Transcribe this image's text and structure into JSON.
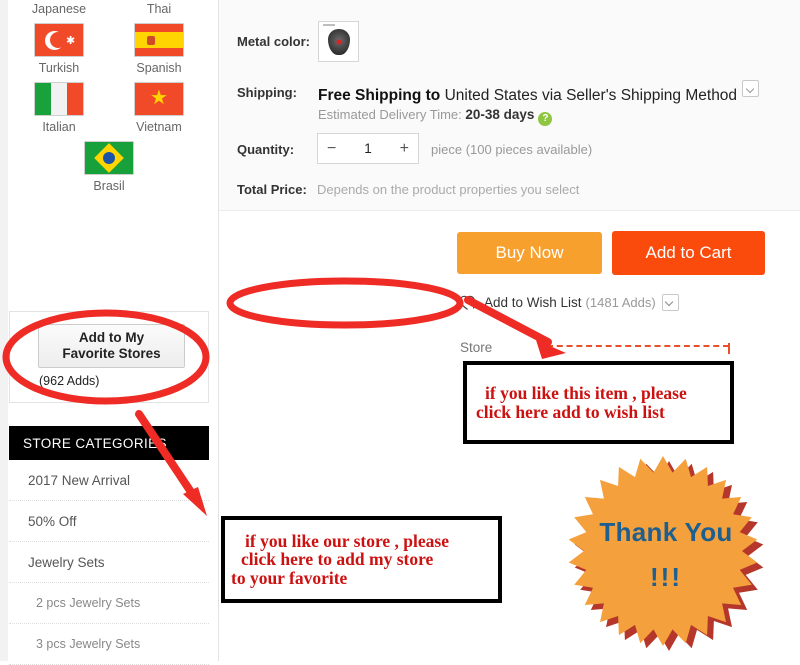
{
  "sidebar": {
    "languages": [
      {
        "label": "Japanese",
        "flag": "jp-flag"
      },
      {
        "label": "Thai",
        "flag": "th-flag"
      },
      {
        "label": "Turkish",
        "flag": "turkish-flag"
      },
      {
        "label": "Spanish",
        "flag": "spanish-flag"
      },
      {
        "label": "Italian",
        "flag": "italian-flag"
      },
      {
        "label": "Vietnam",
        "flag": "vietnam-flag"
      },
      {
        "label": "Brasil",
        "flag": "brasil-flag"
      }
    ],
    "favorite": {
      "button_line1": "Add to My",
      "button_line2": "Favorite Stores",
      "adds": "(962 Adds)"
    },
    "categories_header": "STORE CATEGORIES",
    "categories": [
      {
        "label": "2017 New Arrival",
        "sub": false
      },
      {
        "label": "50% Off",
        "sub": false
      },
      {
        "label": "Jewelry Sets",
        "sub": false
      },
      {
        "label": "2 pcs Jewelry Sets",
        "sub": true
      },
      {
        "label": "3 pcs Jewelry Sets",
        "sub": true
      }
    ]
  },
  "product": {
    "metal_color_label": "Metal color:",
    "shipping_label": "Shipping:",
    "shipping_free": "Free Shipping to",
    "shipping_rest": "United States via Seller's Shipping Method",
    "eta_label": "Estimated Delivery Time:",
    "eta_value": "20-38 days",
    "help_icon_glyph": "?",
    "quantity_label": "Quantity:",
    "quantity_minus": "−",
    "quantity_value": "1",
    "quantity_plus": "+",
    "quantity_note": "piece (100 pieces available)",
    "total_price_label": "Total Price:",
    "total_price_value": "Depends on the product properties you select"
  },
  "actions": {
    "buy_now": "Buy Now",
    "add_to_cart": "Add to Cart",
    "wish_list": "Add to Wish List",
    "wish_list_count": "(1481 Adds)",
    "store_label": "Store"
  },
  "annotations": {
    "wish_note": [
      "if you like this item , please",
      "click here add to wish list"
    ],
    "store_note": [
      "if you like our store , please",
      "click here to add my store",
      "to your favorite"
    ],
    "thanks_line1": "Thank You",
    "thanks_line2": "!!!"
  },
  "colors": {
    "buy_now": "#f7a02e",
    "add_to_cart": "#fa4a0c",
    "annotation_red": "#cc1111",
    "marker_red": "#ee2b24",
    "starburst_orange": "#f4a03c",
    "starburst_shadow": "#b5372b",
    "thanks_text": "#1f5f8f",
    "category_header_bg": "#000000"
  }
}
